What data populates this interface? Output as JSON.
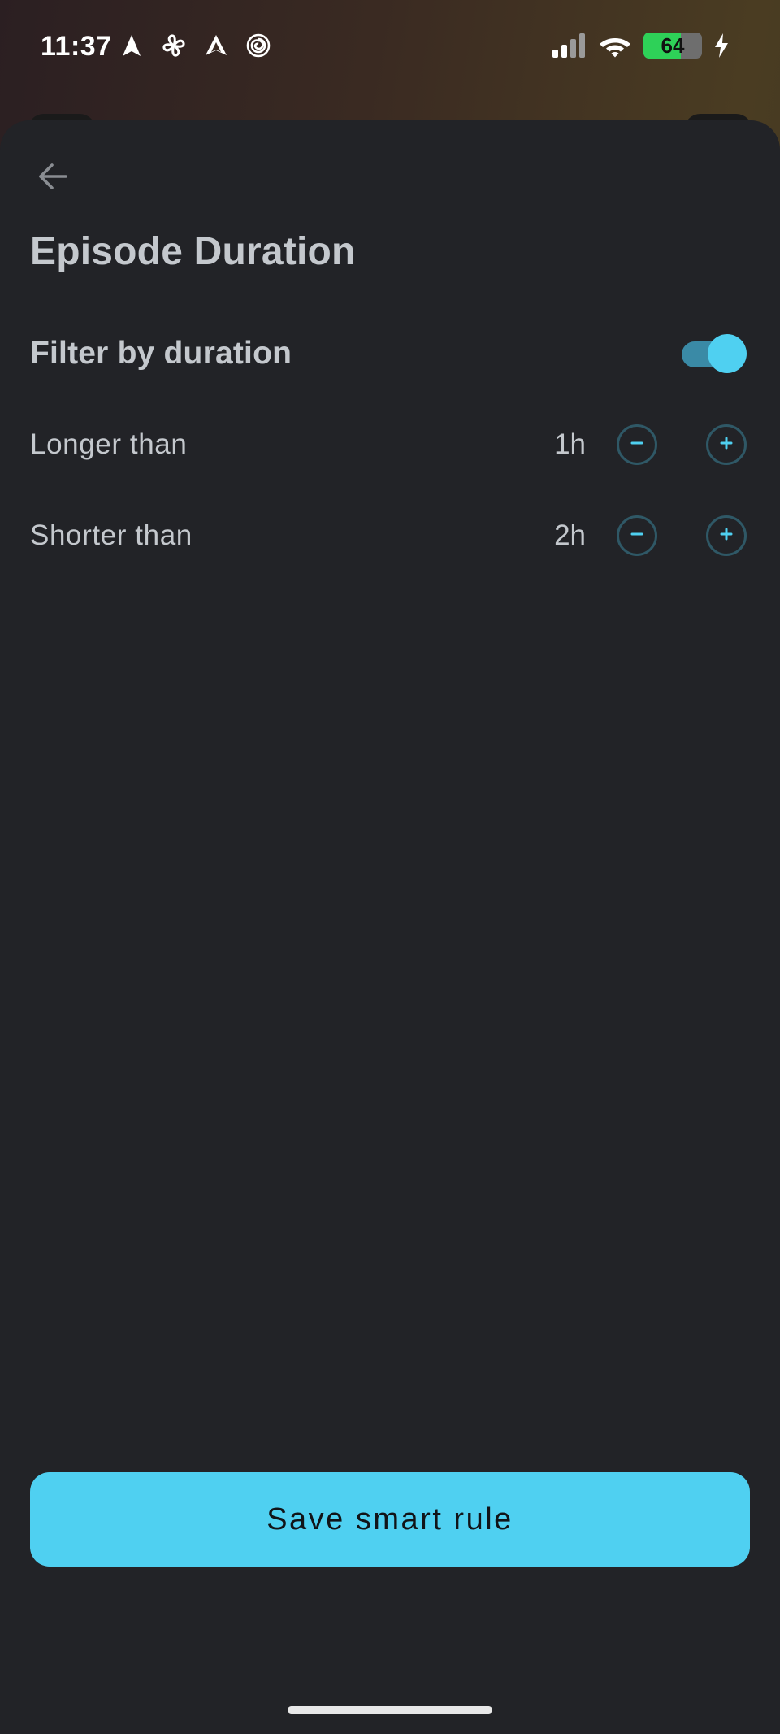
{
  "status_bar": {
    "time": "11:37",
    "battery_level": "64",
    "battery_fraction": 0.64,
    "left_icons": [
      "navigation-icon",
      "fan-icon",
      "arrow-app-icon",
      "spiral-icon"
    ],
    "right_icons": [
      "signal-icon",
      "wifi-icon",
      "battery-icon",
      "charging-bolt-icon"
    ]
  },
  "sheet": {
    "back_icon": "arrow-left-icon",
    "title": "Episode Duration",
    "filter_toggle": {
      "label": "Filter by duration",
      "on": true
    },
    "rows": [
      {
        "label": "Longer than",
        "value": "1h"
      },
      {
        "label": "Shorter than",
        "value": "2h"
      }
    ],
    "save_label": "Save smart rule"
  },
  "colors": {
    "background": "#222327",
    "accent": "#4fd0f1",
    "toggle_track": "#3a8aa6",
    "text": "#c4c8cd",
    "stepper_border": "#2f5866"
  }
}
